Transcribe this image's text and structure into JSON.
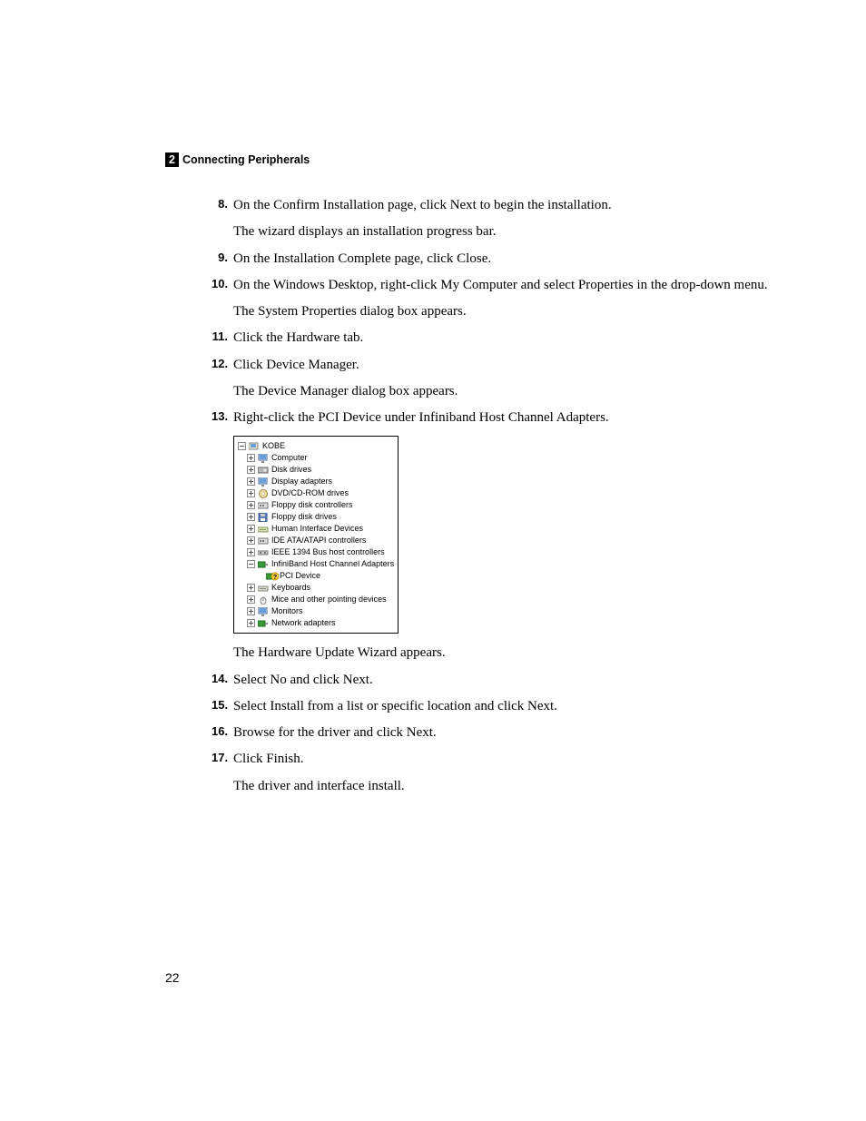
{
  "header": {
    "chapter_number": "2",
    "chapter_title": "Connecting Peripherals"
  },
  "page_number": "22",
  "steps": [
    {
      "num": "8.",
      "lines": [
        "On the Confirm Installation page, click Next to begin the installation.",
        "The wizard displays an installation progress bar."
      ]
    },
    {
      "num": "9.",
      "lines": [
        "On the Installation Complete page, click Close."
      ]
    },
    {
      "num": "10.",
      "lines": [
        "On the Windows Desktop, right-click My Computer and select Properties in the drop-down menu.",
        "The System Properties dialog box appears."
      ]
    },
    {
      "num": "11.",
      "lines": [
        "Click the Hardware tab."
      ]
    },
    {
      "num": "12.",
      "lines": [
        "Click Device Manager.",
        "The Device Manager dialog box appears."
      ]
    },
    {
      "num": "13.",
      "lines": [
        "Right-click the PCI Device under Infiniband Host Channel Adapters."
      ]
    }
  ],
  "after_figure": [
    "The Hardware Update Wizard appears."
  ],
  "steps2": [
    {
      "num": "14.",
      "lines": [
        "Select No and click Next."
      ]
    },
    {
      "num": "15.",
      "lines": [
        "Select Install from a list or specific location and click Next."
      ]
    },
    {
      "num": "16.",
      "lines": [
        "Browse for the driver and click Next."
      ]
    },
    {
      "num": "17.",
      "lines": [
        "Click Finish.",
        "The driver and interface install."
      ]
    }
  ],
  "device_tree": {
    "root_label": "KOBE",
    "nodes": [
      {
        "label": "Computer",
        "icon": "monitor"
      },
      {
        "label": "Disk drives",
        "icon": "disk"
      },
      {
        "label": "Display adapters",
        "icon": "monitor"
      },
      {
        "label": "DVD/CD-ROM drives",
        "icon": "cd"
      },
      {
        "label": "Floppy disk controllers",
        "icon": "controller"
      },
      {
        "label": "Floppy disk drives",
        "icon": "floppy"
      },
      {
        "label": "Human Interface Devices",
        "icon": "hid"
      },
      {
        "label": "IDE ATA/ATAPI controllers",
        "icon": "controller"
      },
      {
        "label": "IEEE 1394 Bus host controllers",
        "icon": "bus"
      },
      {
        "label": "InfiniBand Host Channel Adapters",
        "icon": "network",
        "expanded": true,
        "children": [
          {
            "label": "PCI Device",
            "icon": "pci-warn"
          }
        ]
      },
      {
        "label": "Keyboards",
        "icon": "keyboard"
      },
      {
        "label": "Mice and other pointing devices",
        "icon": "mouse"
      },
      {
        "label": "Monitors",
        "icon": "monitor"
      },
      {
        "label": "Network adapters",
        "icon": "network"
      }
    ]
  }
}
